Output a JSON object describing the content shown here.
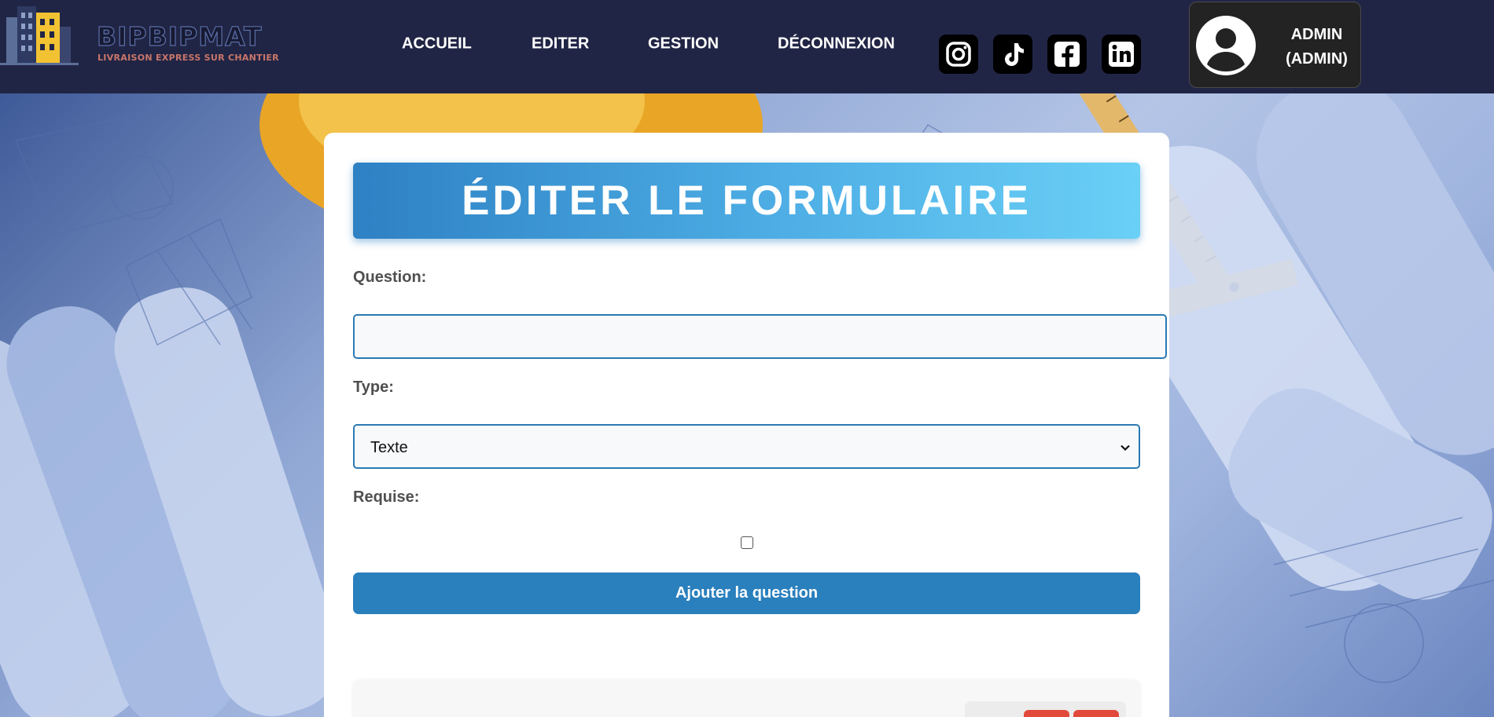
{
  "brand": {
    "name": "BIPBIPMAT",
    "tagline": "LIVRAISON EXPRESS SUR CHANTIER"
  },
  "nav": {
    "links": [
      "ACCUEIL",
      "EDITER",
      "GESTION",
      "DÉCONNEXION"
    ]
  },
  "social": [
    "instagram-icon",
    "tiktok-icon",
    "facebook-icon",
    "linkedin-icon"
  ],
  "user": {
    "name_line1": "ADMIN",
    "name_line2": "(ADMIN)"
  },
  "form": {
    "title": "ÉDITER LE FORMULAIRE",
    "question_label": "Question:",
    "question_value": "",
    "type_label": "Type:",
    "type_selected": "Texte",
    "required_label": "Requise:",
    "required_checked": false,
    "submit_label": "Ajouter la question"
  },
  "colors": {
    "header_bg": "#212545",
    "primary": "#2a7fbd",
    "danger": "#e14a3b"
  }
}
